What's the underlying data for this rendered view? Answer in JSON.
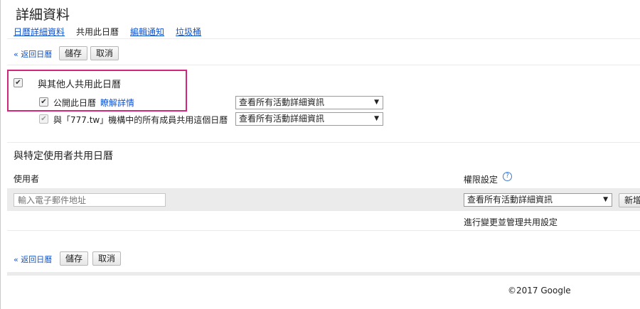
{
  "page": {
    "title": "詳細資料"
  },
  "tabs": [
    {
      "label": "日曆詳細資料"
    },
    {
      "label": "共用此日曆"
    },
    {
      "label": "編輯通知"
    },
    {
      "label": "垃圾桶"
    }
  ],
  "toolbar": {
    "back_label": "« 返回日曆",
    "save_label": "儲存",
    "cancel_label": "取消"
  },
  "sharing": {
    "share_with_others_label": "與其他人共用此日曆",
    "share_with_others_checked": true,
    "public_label": "公開此日曆",
    "public_checked": true,
    "learn_more_label": "瞭解詳情",
    "public_select": "查看所有活動詳細資訊",
    "org_label": "與「777.tw」機構中的所有成員共用這個日曆",
    "org_checked": true,
    "org_select": "查看所有活動詳細資訊"
  },
  "specific": {
    "heading": "與特定使用者共用日曆",
    "user_col": "使用者",
    "perm_col": "權限設定",
    "help_icon": "?",
    "email_placeholder": "輸入電子郵件地址",
    "perm_select": "查看所有活動詳細資訊",
    "add_label": "新增",
    "note": "進行變更並管理共用設定"
  },
  "footer": {
    "copyright": "©2017 Google"
  },
  "colors": {
    "link": "#1155cc",
    "highlight": "#d1267e",
    "row_bg": "#ebebeb"
  }
}
